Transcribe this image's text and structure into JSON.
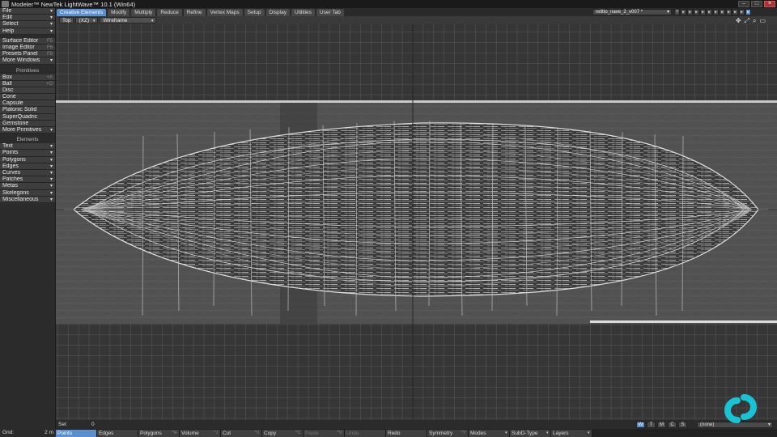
{
  "window": {
    "title": "Modeler™ NewTek LightWave™ 10.1 (Win64)"
  },
  "left_menu": {
    "top_items": [
      {
        "label": "File",
        "arrow": "▾"
      },
      {
        "label": "Edit",
        "arrow": "▾"
      },
      {
        "label": "Select",
        "arrow": "▾"
      },
      {
        "label": "Help",
        "arrow": "▾"
      }
    ],
    "tool_items": [
      {
        "label": "Surface Editor",
        "key": "F5"
      },
      {
        "label": "Image Editor",
        "key": "F6"
      },
      {
        "label": "Presets Panel",
        "key": "F8"
      },
      {
        "label": "More Windows",
        "arrow": "▾"
      }
    ],
    "primitives_title": "Primitives",
    "primitives": [
      {
        "label": "Box",
        "key": "+X"
      },
      {
        "label": "Ball",
        "key": "+O"
      },
      {
        "label": "Disc"
      },
      {
        "label": "Cone"
      },
      {
        "label": "Capsule"
      },
      {
        "label": "Platonic Solid"
      },
      {
        "label": "SuperQuadric"
      },
      {
        "label": "Gemstone"
      },
      {
        "label": "More Primitives",
        "arrow": "▾"
      }
    ],
    "elements_title": "Elements",
    "elements": [
      {
        "label": "Text",
        "arrow": "▾"
      },
      {
        "label": "Points",
        "arrow": "▾"
      },
      {
        "label": "Polygons",
        "arrow": "▾"
      },
      {
        "label": "Edges",
        "arrow": "▾"
      },
      {
        "label": "Curves",
        "arrow": "▾"
      },
      {
        "label": "Patches",
        "arrow": "▾"
      },
      {
        "label": "Metas",
        "arrow": "▾"
      },
      {
        "label": "Skelegons",
        "arrow": "▾"
      },
      {
        "label": "Miscellaneous",
        "arrow": "▾"
      }
    ]
  },
  "tabs": [
    "Creative Elements",
    "Modify",
    "Multiply",
    "Reduce",
    "Refine",
    "Vertex Maps",
    "Setup",
    "Display",
    "Utilities",
    "User Tab"
  ],
  "active_tab": "Creative Elements",
  "file_selector": {
    "value": "relitto_nave_2_v007 *",
    "arrow": "▾"
  },
  "tab_icons": [
    "?",
    "▸",
    "▸",
    "▸",
    "▸",
    "▸",
    "▸",
    "▸",
    "▸",
    "▸",
    "▸",
    "▸"
  ],
  "viewport": {
    "view": "Top",
    "axes": "(XZ)",
    "mode": "Wireframe",
    "arrow": "▾",
    "icons": [
      "✥",
      "⤢",
      "⌕",
      "▭"
    ]
  },
  "selection": {
    "label": "Sel:",
    "value": "0"
  },
  "view_buttons": [
    "W",
    "T",
    "M",
    "C",
    "S"
  ],
  "active_view_button": "W",
  "layer_select": {
    "value": "(none)",
    "arrow": "▾"
  },
  "bottom_bar": {
    "grid_label": "Gnd:",
    "grid_value": "2 m",
    "buttons": [
      {
        "label": "Points",
        "key": "^G",
        "active": true
      },
      {
        "label": "Edges",
        "key": ""
      },
      {
        "label": "Polygons",
        "key": "^H"
      },
      {
        "label": "Volume",
        "key": "^J"
      },
      {
        "label": "Cut",
        "key": "^X"
      },
      {
        "label": "Copy",
        "key": "^C"
      },
      {
        "label": "Paste",
        "key": "^V",
        "dim": true
      },
      {
        "label": "Undo",
        "key": "",
        "dim": true
      },
      {
        "label": "Redo",
        "key": ""
      },
      {
        "label": "Symmetry",
        "key": "^Y"
      },
      {
        "label": "Modes",
        "arrow": "▾"
      },
      {
        "label": "SubD-Type",
        "arrow": "▾"
      },
      {
        "label": "Layers",
        "arrow": "▾"
      }
    ]
  },
  "colors": {
    "accent": "#5a8fd0",
    "logo": "#19c3d6",
    "grid": "#545454",
    "background": "#363636"
  }
}
